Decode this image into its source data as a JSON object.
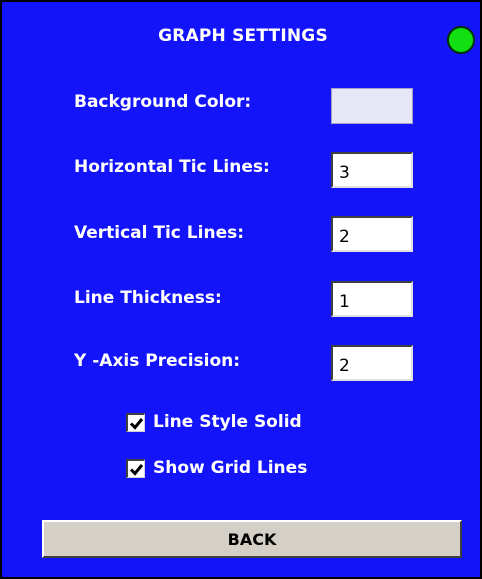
{
  "dialog": {
    "title": "GRAPH SETTINGS",
    "status_color": "#13e013"
  },
  "settings": {
    "background_color": {
      "label": "Background Color:",
      "value": "#e6e6f5"
    },
    "horizontal_tic_lines": {
      "label": "Horizontal Tic Lines:",
      "value": "3"
    },
    "vertical_tic_lines": {
      "label": "Vertical Tic Lines:",
      "value": "2"
    },
    "line_thickness": {
      "label": "Line Thickness:",
      "value": "1"
    },
    "y_axis_precision": {
      "label": "Y -Axis Precision:",
      "value": "2"
    }
  },
  "options": {
    "line_style_solid": {
      "label": "Line Style Solid",
      "checked": true
    },
    "show_grid_lines": {
      "label": "Show Grid Lines",
      "checked": true
    }
  },
  "actions": {
    "back_label": "BACK"
  },
  "theme": {
    "panel_background": "#1414fa",
    "text_color": "#ffffff"
  }
}
